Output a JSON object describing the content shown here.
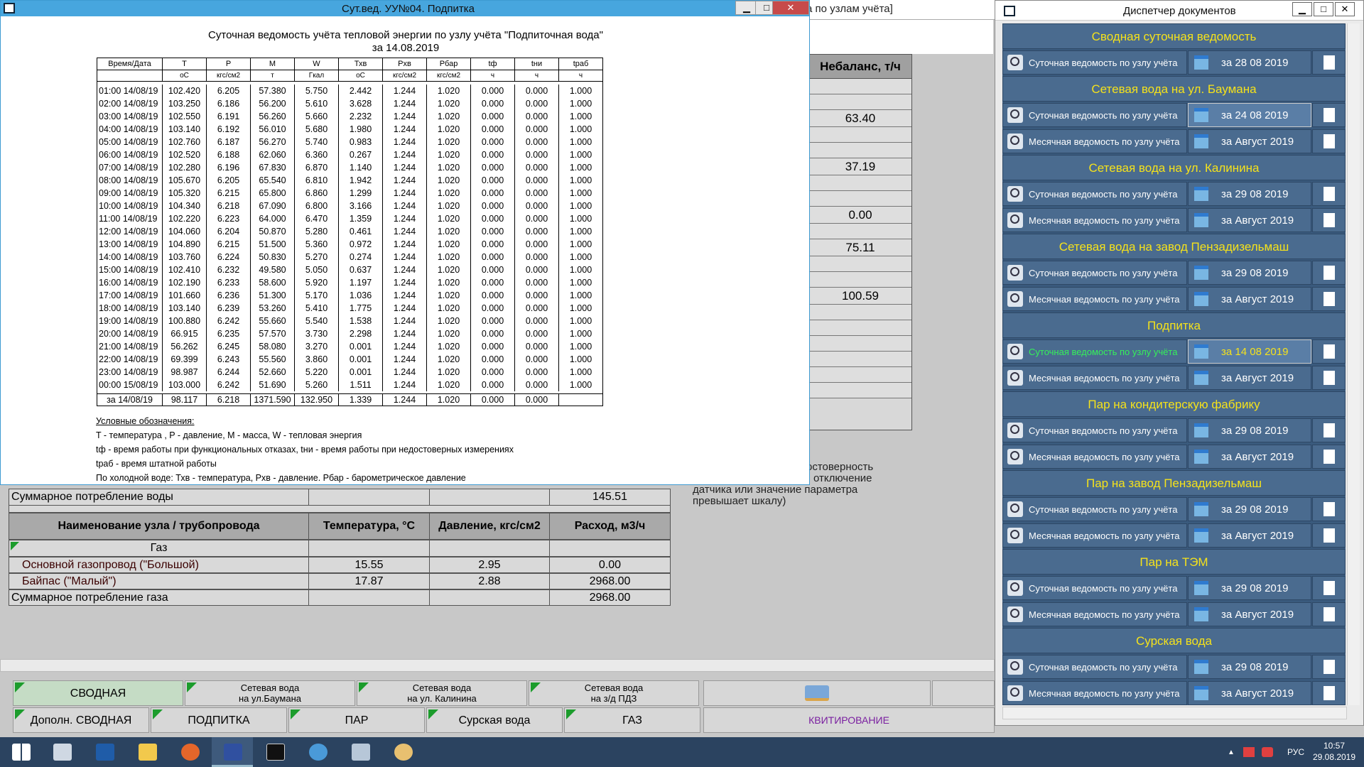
{
  "bg": {
    "title_fragment": "а по узлам учёта]",
    "balance_header": "Небаланс, т/ч",
    "balance_values": [
      "63.40",
      "37.19",
      "0.00",
      "75.11",
      "100.59"
    ],
    "note_lines": [
      "остоверность",
      "отключение",
      "датчика или значение параметра",
      "превышает шкалу)"
    ],
    "water_total_label": "Суммарное потребление воды",
    "water_total_value": "145.51",
    "gas_headers": [
      "Наименование узла / трубопровода",
      "Температура, °C",
      "Давление, кгс/см2",
      "Расход, м3/ч"
    ],
    "gas_group": "Газ",
    "gas_rows": [
      {
        "name": "Основной газопровод (\"Большой)",
        "t": "15.55",
        "p": "2.95",
        "q": "0.00"
      },
      {
        "name": "Байпас (\"Малый\")",
        "t": "17.87",
        "p": "2.88",
        "q": "2968.00"
      }
    ],
    "gas_total_label": "Суммарное потребление газа",
    "gas_total_value": "2968.00",
    "buttons_row1": [
      {
        "line1": "СВОДНАЯ",
        "line2": ""
      },
      {
        "line1": "Сетевая вода",
        "line2": "на ул.Баумана"
      },
      {
        "line1": "Сетевая вода",
        "line2": "на ул. Калинина"
      },
      {
        "line1": "Сетевая вода",
        "line2": "на з/д ПДЗ"
      }
    ],
    "buttons_row2": [
      "Дополн. СВОДНАЯ",
      "ПОДПИТКА",
      "ПАР",
      "Сурская вода",
      "ГАЗ"
    ],
    "kvit": "КВИТИРОВАНИЕ"
  },
  "report": {
    "window_title": "Сут.вед. УУ№04. Подпитка",
    "heading": "Суточная  ведомость учёта тепловой энергии по узлу учёта \"Подпиточная вода\"",
    "date_line": "за 14.08.2019",
    "columns": [
      "Время/Дата",
      "T",
      "P",
      "M",
      "W",
      "Тхв",
      "Рхв",
      "Рбар",
      "tф",
      "tни",
      "tраб"
    ],
    "units": [
      "",
      "оС",
      "кгс/см2",
      "т",
      "Гкал",
      "оС",
      "кгс/см2",
      "кгс/см2",
      "ч",
      "ч",
      "ч"
    ],
    "rows": [
      [
        "01:00 14/08/19",
        "102.420",
        "6.205",
        "57.380",
        "5.750",
        "2.442",
        "1.244",
        "1.020",
        "0.000",
        "0.000",
        "1.000"
      ],
      [
        "02:00 14/08/19",
        "103.250",
        "6.186",
        "56.200",
        "5.610",
        "3.628",
        "1.244",
        "1.020",
        "0.000",
        "0.000",
        "1.000"
      ],
      [
        "03:00 14/08/19",
        "102.550",
        "6.191",
        "56.260",
        "5.660",
        "2.232",
        "1.244",
        "1.020",
        "0.000",
        "0.000",
        "1.000"
      ],
      [
        "04:00 14/08/19",
        "103.140",
        "6.192",
        "56.010",
        "5.680",
        "1.980",
        "1.244",
        "1.020",
        "0.000",
        "0.000",
        "1.000"
      ],
      [
        "05:00 14/08/19",
        "102.760",
        "6.187",
        "56.270",
        "5.740",
        "0.983",
        "1.244",
        "1.020",
        "0.000",
        "0.000",
        "1.000"
      ],
      [
        "06:00 14/08/19",
        "102.520",
        "6.188",
        "62.060",
        "6.360",
        "0.267",
        "1.244",
        "1.020",
        "0.000",
        "0.000",
        "1.000"
      ],
      [
        "07:00 14/08/19",
        "102.280",
        "6.196",
        "67.830",
        "6.870",
        "1.140",
        "1.244",
        "1.020",
        "0.000",
        "0.000",
        "1.000"
      ],
      [
        "08:00 14/08/19",
        "105.670",
        "6.205",
        "65.540",
        "6.810",
        "1.942",
        "1.244",
        "1.020",
        "0.000",
        "0.000",
        "1.000"
      ],
      [
        "09:00 14/08/19",
        "105.320",
        "6.215",
        "65.800",
        "6.860",
        "1.299",
        "1.244",
        "1.020",
        "0.000",
        "0.000",
        "1.000"
      ],
      [
        "10:00 14/08/19",
        "104.340",
        "6.218",
        "67.090",
        "6.800",
        "3.166",
        "1.244",
        "1.020",
        "0.000",
        "0.000",
        "1.000"
      ],
      [
        "11:00 14/08/19",
        "102.220",
        "6.223",
        "64.000",
        "6.470",
        "1.359",
        "1.244",
        "1.020",
        "0.000",
        "0.000",
        "1.000"
      ],
      [
        "12:00 14/08/19",
        "104.060",
        "6.204",
        "50.870",
        "5.280",
        "0.461",
        "1.244",
        "1.020",
        "0.000",
        "0.000",
        "1.000"
      ],
      [
        "13:00 14/08/19",
        "104.890",
        "6.215",
        "51.500",
        "5.360",
        "0.972",
        "1.244",
        "1.020",
        "0.000",
        "0.000",
        "1.000"
      ],
      [
        "14:00 14/08/19",
        "103.760",
        "6.224",
        "50.830",
        "5.270",
        "0.274",
        "1.244",
        "1.020",
        "0.000",
        "0.000",
        "1.000"
      ],
      [
        "15:00 14/08/19",
        "102.410",
        "6.232",
        "49.580",
        "5.050",
        "0.637",
        "1.244",
        "1.020",
        "0.000",
        "0.000",
        "1.000"
      ],
      [
        "16:00 14/08/19",
        "102.190",
        "6.233",
        "58.600",
        "5.920",
        "1.197",
        "1.244",
        "1.020",
        "0.000",
        "0.000",
        "1.000"
      ],
      [
        "17:00 14/08/19",
        "101.660",
        "6.236",
        "51.300",
        "5.170",
        "1.036",
        "1.244",
        "1.020",
        "0.000",
        "0.000",
        "1.000"
      ],
      [
        "18:00 14/08/19",
        "103.140",
        "6.239",
        "53.260",
        "5.410",
        "1.775",
        "1.244",
        "1.020",
        "0.000",
        "0.000",
        "1.000"
      ],
      [
        "19:00 14/08/19",
        "100.880",
        "6.242",
        "55.660",
        "5.540",
        "1.538",
        "1.244",
        "1.020",
        "0.000",
        "0.000",
        "1.000"
      ],
      [
        "20:00 14/08/19",
        "66.915",
        "6.235",
        "57.570",
        "3.730",
        "2.298",
        "1.244",
        "1.020",
        "0.000",
        "0.000",
        "1.000"
      ],
      [
        "21:00 14/08/19",
        "56.262",
        "6.245",
        "58.080",
        "3.270",
        "0.001",
        "1.244",
        "1.020",
        "0.000",
        "0.000",
        "1.000"
      ],
      [
        "22:00 14/08/19",
        "69.399",
        "6.243",
        "55.560",
        "3.860",
        "0.001",
        "1.244",
        "1.020",
        "0.000",
        "0.000",
        "1.000"
      ],
      [
        "23:00 14/08/19",
        "98.987",
        "6.244",
        "52.660",
        "5.220",
        "0.001",
        "1.244",
        "1.020",
        "0.000",
        "0.000",
        "1.000"
      ],
      [
        "00:00 15/08/19",
        "103.000",
        "6.242",
        "51.690",
        "5.260",
        "1.511",
        "1.244",
        "1.020",
        "0.000",
        "0.000",
        "1.000"
      ]
    ],
    "total": [
      "за 14/08/19",
      "98.117",
      "6.218",
      "1371.590",
      "132.950",
      "1.339",
      "1.244",
      "1.020",
      "0.000",
      "0.000",
      ""
    ],
    "legend": [
      "Условные обозначения:",
      "T - температура , P - давление, M - масса, W - тепловая энергия",
      "tф - время работы при функциональных отказах, tни - время работы при недостоверных измерениях",
      "tраб - время штатной работы",
      "По холодной воде: Тхв - температура, Рхв - давление. Рбар - барометрическое давление"
    ]
  },
  "dm": {
    "title": "Диспетчер документов",
    "groups": [
      {
        "name": "Сводная суточная ведомость",
        "items": [
          {
            "name": "Суточная ведомость по узлу учёта",
            "date": "за 28 08 2019"
          }
        ]
      },
      {
        "name": "Сетевая вода на ул. Баумана",
        "items": [
          {
            "name": "Суточная ведомость по узлу учёта",
            "date": "за 24 08 2019",
            "date_active": true
          },
          {
            "name": "Месячная ведомость по узлу учёта",
            "date": "за Август 2019"
          }
        ]
      },
      {
        "name": "Сетевая вода на ул. Калинина",
        "items": [
          {
            "name": "Суточная ведомость по узлу учёта",
            "date": "за 29 08 2019"
          },
          {
            "name": "Месячная ведомость по узлу учёта",
            "date": "за Август 2019"
          }
        ]
      },
      {
        "name": "Сетевая вода на завод Пензадизельмаш",
        "items": [
          {
            "name": "Суточная ведомость по узлу учёта",
            "date": "за 29 08 2019"
          },
          {
            "name": "Месячная ведомость по узлу учёта",
            "date": "за Август 2019"
          }
        ]
      },
      {
        "name": "Подпитка",
        "items": [
          {
            "name": "Суточная ведомость по узлу учёта",
            "date": "за 14 08 2019",
            "active": true
          },
          {
            "name": "Месячная ведомость по узлу учёта",
            "date": "за Август 2019"
          }
        ]
      },
      {
        "name": "Пар на кондитерскую фабрику",
        "items": [
          {
            "name": "Суточная ведомость по узлу учёта",
            "date": "за 29 08 2019"
          },
          {
            "name": "Месячная ведомость по узлу учёта",
            "date": "за Август 2019"
          }
        ]
      },
      {
        "name": "Пар на завод Пензадизельмаш",
        "items": [
          {
            "name": "Суточная ведомость по узлу учёта",
            "date": "за 29 08 2019"
          },
          {
            "name": "Месячная ведомость по узлу учёта",
            "date": "за Август 2019"
          }
        ]
      },
      {
        "name": "Пар на ТЭМ",
        "items": [
          {
            "name": "Суточная ведомость по узлу учёта",
            "date": "за 29 08 2019"
          },
          {
            "name": "Месячная ведомость по узлу учёта",
            "date": "за Август 2019"
          }
        ]
      },
      {
        "name": "Сурская вода",
        "items": [
          {
            "name": "Суточная ведомость по узлу учёта",
            "date": "за 29 08 2019"
          },
          {
            "name": "Месячная ведомость по узлу учёта",
            "date": "за Август 2019"
          }
        ]
      }
    ]
  },
  "taskbar": {
    "lang": "РУС",
    "time": "10:57",
    "date": "29.08.2019",
    "colors": {
      "accent": "#47a6de",
      "group_text": "#f5e21b",
      "active_text": "#35f05a"
    }
  }
}
